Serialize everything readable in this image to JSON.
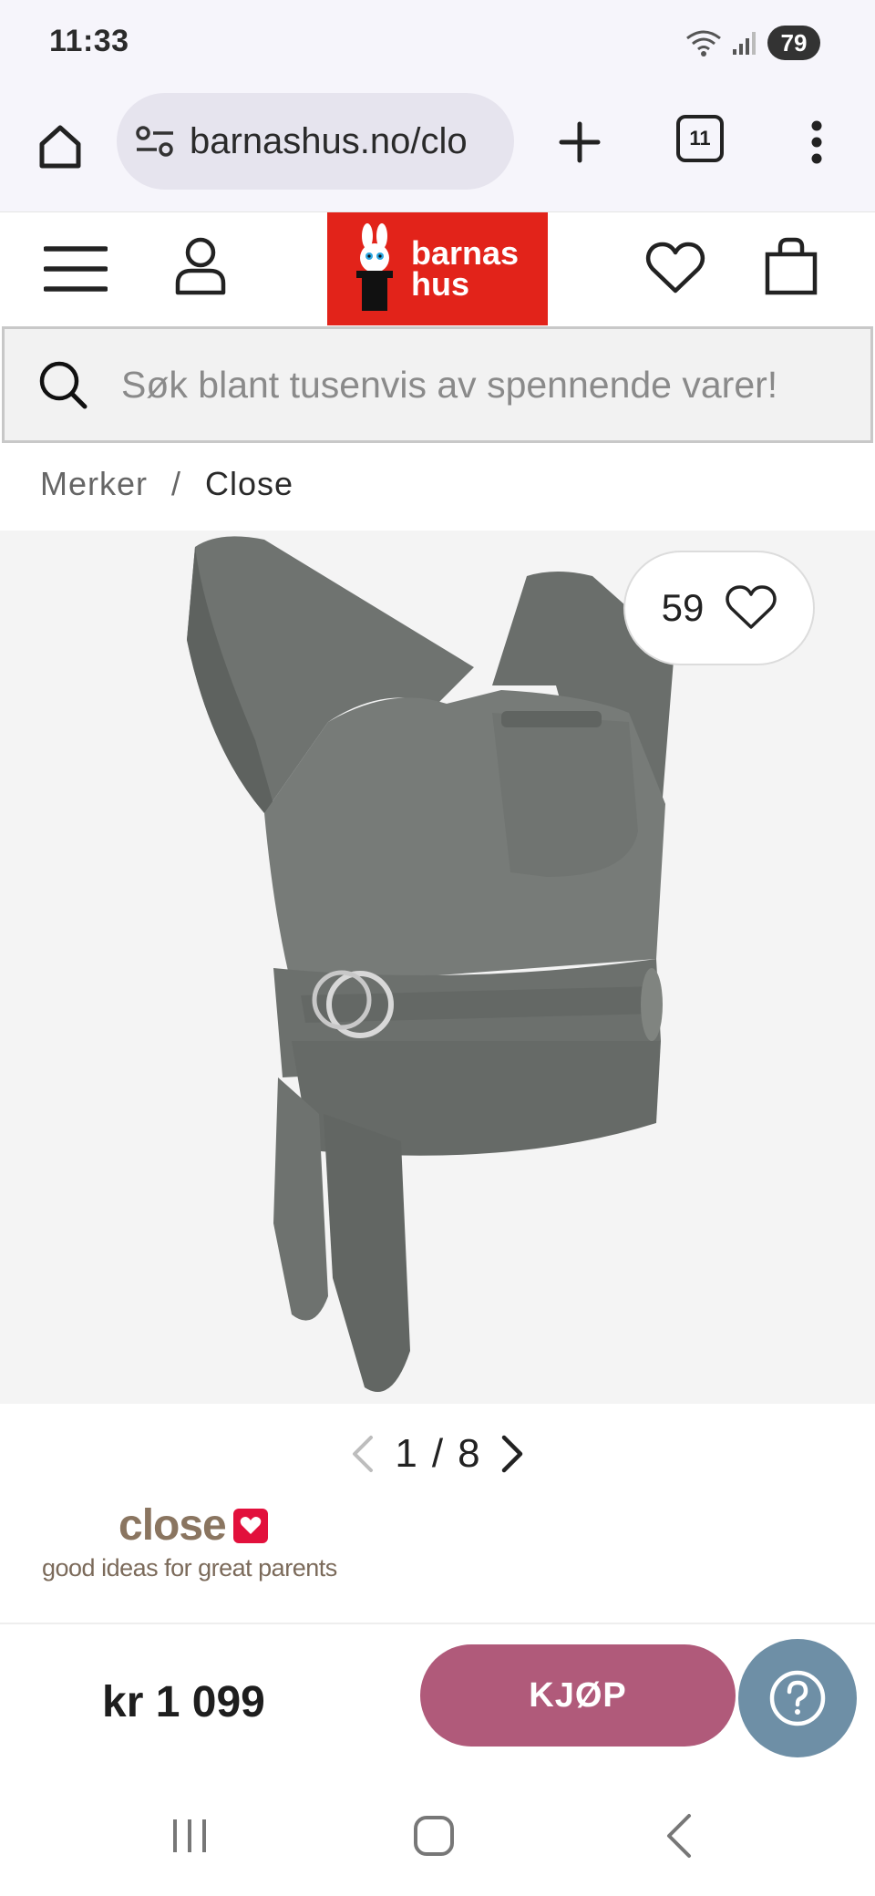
{
  "status_bar": {
    "time": "11:33",
    "battery": "79",
    "icons": [
      "wifi-icon",
      "signal-icon",
      "battery-icon"
    ]
  },
  "browser": {
    "url": "barnashus.no/clo",
    "tab_count": "11",
    "icons": [
      "home-icon",
      "site-settings-icon",
      "plus-icon",
      "tabs-icon",
      "more-vert-icon"
    ]
  },
  "header": {
    "logo_text_line1": "barnas",
    "logo_text_line2": "hus",
    "icons": [
      "menu-icon",
      "account-icon",
      "heart-icon",
      "shopping-bag-icon"
    ],
    "brand_color": "#e2231a"
  },
  "search": {
    "placeholder": "Søk blant tusenvis av spennende varer!"
  },
  "breadcrumb": {
    "items": [
      "Merker",
      "Close"
    ],
    "separator": "/"
  },
  "product": {
    "favorites_count": "59",
    "image_index": "1",
    "image_separator": "/",
    "image_total": "8",
    "product_color": "#6b6f6c"
  },
  "brand": {
    "name": "close",
    "tagline": "good ideas for great parents"
  },
  "buy_bar": {
    "price": "kr 1 099",
    "buy_label": "KJØP",
    "buy_color": "#b05a7a",
    "help_color": "#6e8fa6"
  },
  "system_nav": {
    "icons": [
      "recent-apps-icon",
      "home-icon",
      "back-icon"
    ]
  }
}
